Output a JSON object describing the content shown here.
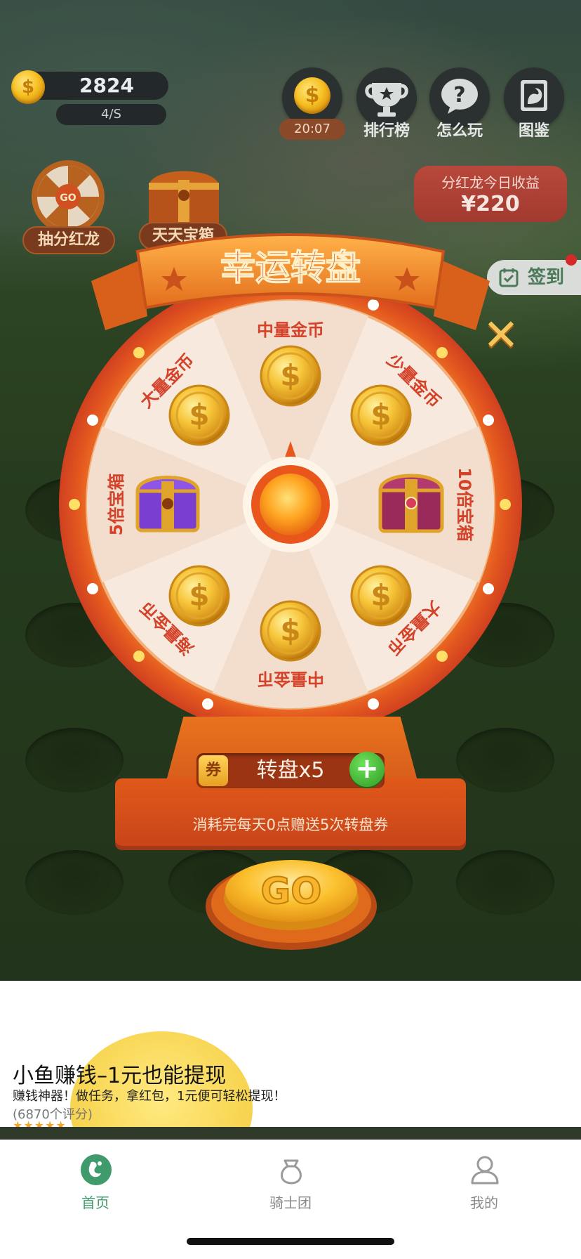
{
  "top_bar": {
    "coins": "2824",
    "rate": "4/S",
    "timer": "20:07",
    "buttons": [
      {
        "label": "排行榜",
        "icon": "trophy-icon"
      },
      {
        "label": "怎么玩",
        "icon": "question-icon"
      },
      {
        "label": "图鉴",
        "icon": "album-icon"
      }
    ]
  },
  "earnings": {
    "title": "分红龙今日收益",
    "value": "¥220"
  },
  "sign_in": {
    "label": "签到"
  },
  "side": {
    "wheel_entry": {
      "label": "抽分红龙",
      "go": "GO"
    },
    "chest_entry": {
      "label": "天天宝箱"
    }
  },
  "wheel": {
    "title": "幸运转盘",
    "segments": [
      {
        "label": "中量金币",
        "reward": "coin"
      },
      {
        "label": "少量金币",
        "reward": "coin"
      },
      {
        "label": "10倍宝箱",
        "reward": "chest-red"
      },
      {
        "label": "大量金币",
        "reward": "coin"
      },
      {
        "label": "中量金币",
        "reward": "coin"
      },
      {
        "label": "海量金币",
        "reward": "coin"
      },
      {
        "label": "5倍宝箱",
        "reward": "chest-purple"
      },
      {
        "label": "大量金币",
        "reward": "coin"
      }
    ],
    "ticket_icon": "券",
    "ticket_text": "转盘x5",
    "note": "消耗完每天0点赠送5次转盘券",
    "go": "GO",
    "close": "✕"
  },
  "ad": {
    "title": "小鱼赚钱–1元也能提现",
    "desc": "赚钱神器！做任务，拿红包，1元便可轻松提现！",
    "rating_text": "(6870个评分)",
    "stars": "★★★★★"
  },
  "tabbar": {
    "tabs": [
      {
        "label": "首页",
        "active": true
      },
      {
        "label": "骑士团",
        "active": false
      },
      {
        "label": "我的",
        "active": false
      }
    ],
    "active_color": "#3f9a6c",
    "inactive_color": "#8a8a8a"
  }
}
